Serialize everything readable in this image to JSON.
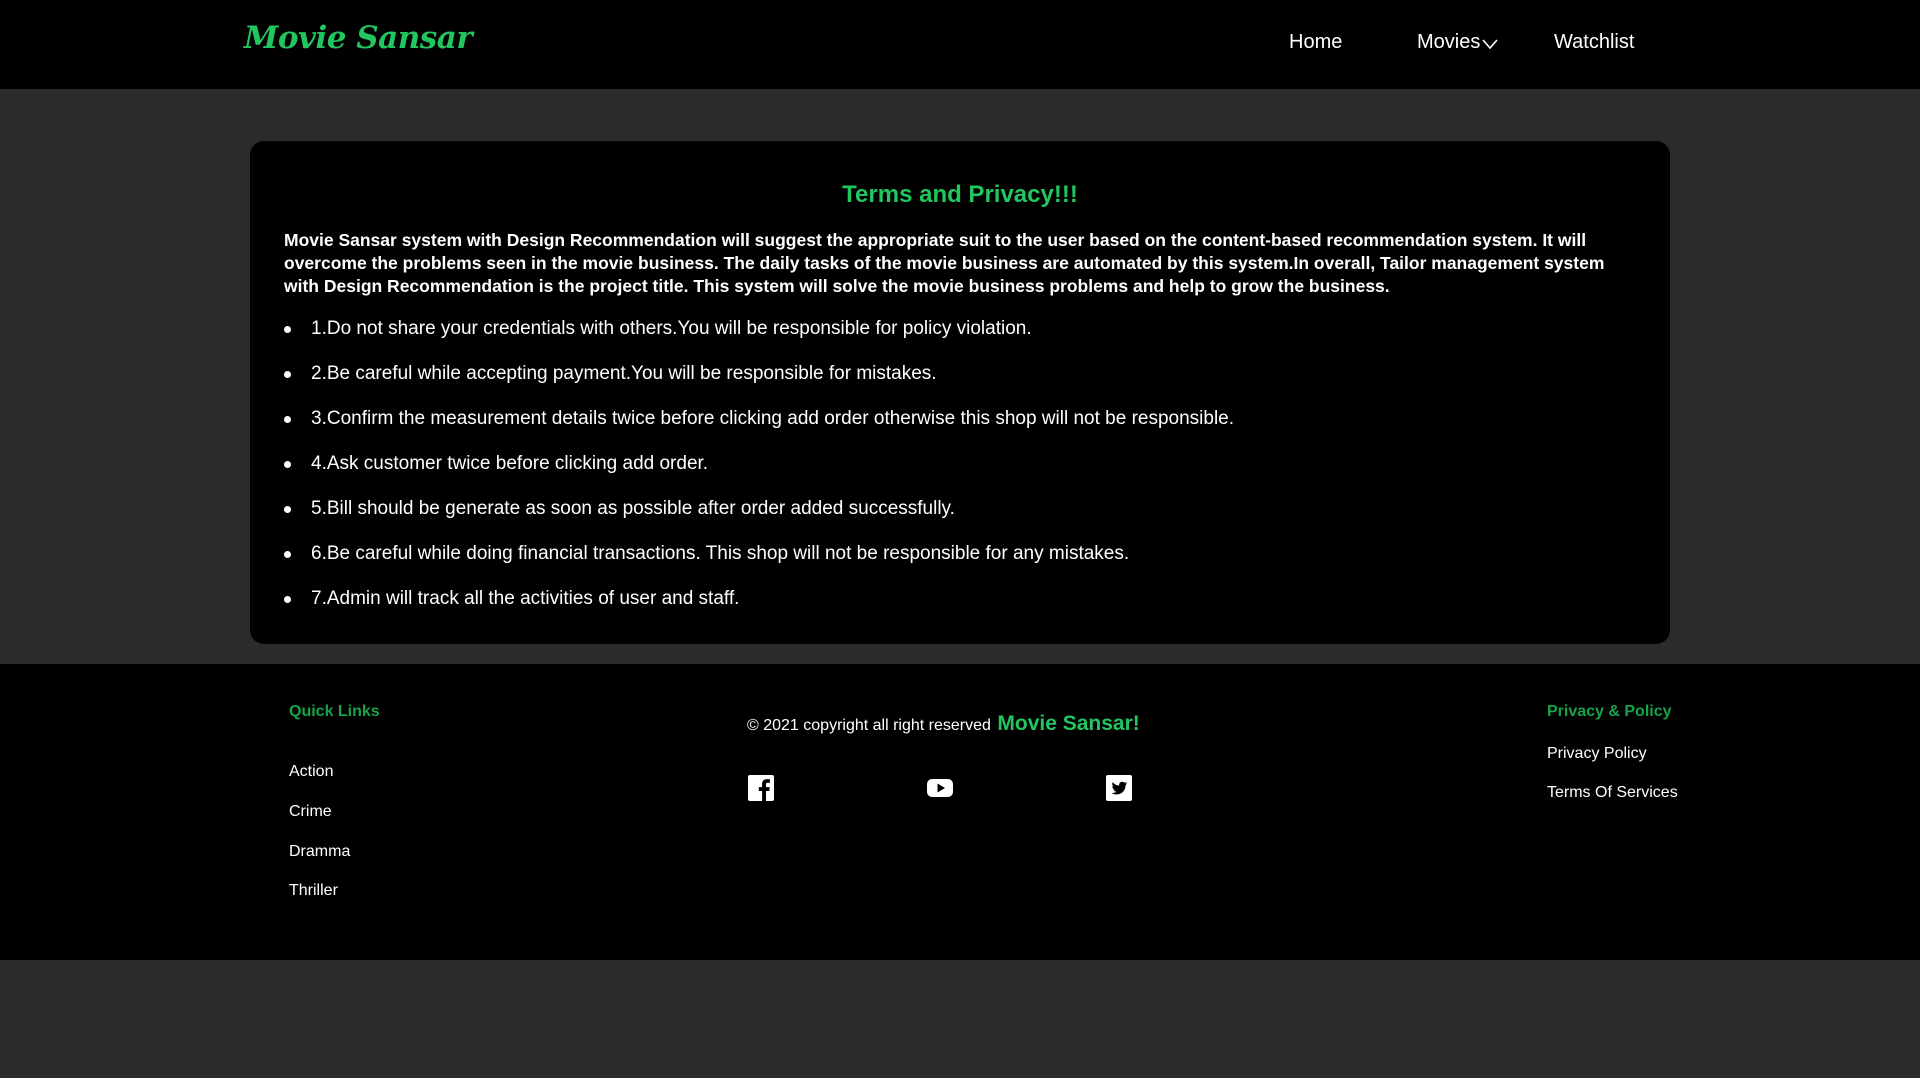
{
  "navbar": {
    "logo": "Movie Sansar",
    "home": "Home",
    "movies": "Movies",
    "watchlist": "Watchlist"
  },
  "card": {
    "title": "Terms and Privacy!!!",
    "intro": "Movie Sansar system with Design Recommendation will suggest the appropriate suit to the user based on the content-based recommendation system. It will overcome the problems seen in the movie business. The daily tasks of the movie business are automated by this system.In overall, Tailor management system with Design Recommendation is the project title. This system will solve the movie business problems and help to grow the business.",
    "rules": [
      "1.Do not share your credentials with others.You will be responsible for policy violation.",
      "2.Be careful while accepting payment.You will be responsible for mistakes.",
      "3.Confirm the measurement details twice before clicking add order otherwise this shop will not be responsible.",
      "4.Ask customer twice before clicking add order.",
      "5.Bill should be generate as soon as possible after order added successfully.",
      "6.Be careful while doing financial transactions. This shop will not be responsible for any mistakes.",
      "7.Admin will track all the activities of user and staff."
    ]
  },
  "footer": {
    "quick_links_heading": "Quick Links",
    "quick_links": [
      "Action",
      "Crime",
      "Dramma",
      "Thriller"
    ],
    "copyright_text": "© 2021 copyright all right reserved",
    "copyright_brand": "Movie Sansar!",
    "social_icons": [
      "facebook-icon",
      "youtube-icon",
      "twitter-icon"
    ],
    "privacy_heading": "Privacy & Policy",
    "privacy_links": [
      "Privacy Policy",
      "Terms Of Services"
    ]
  },
  "colors": {
    "accent": "#22c55e",
    "footer_heading": "#16a34a",
    "page_bg": "#2b2b2b",
    "panel_bg": "#000000"
  }
}
